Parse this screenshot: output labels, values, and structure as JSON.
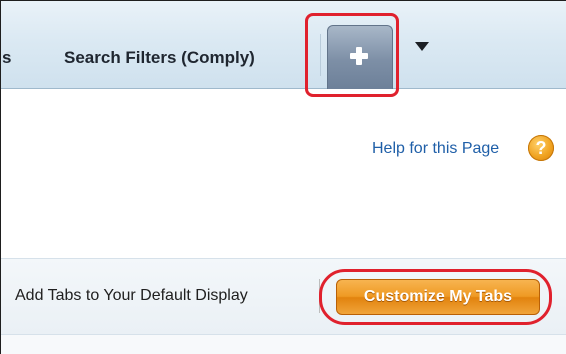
{
  "tabs": {
    "partial_label": "s",
    "search_filters_label": "Search Filters (Comply)",
    "add_tab_icon": "plus-icon",
    "dropdown_icon": "chevron-down-icon"
  },
  "help": {
    "link_label": "Help for this Page",
    "icon_label": "?"
  },
  "tabs_row": {
    "label": "Add Tabs to Your Default Display",
    "customize_button": "Customize My Tabs"
  },
  "colors": {
    "highlight": "#e0212d",
    "button_orange": "#ef9a24",
    "link_blue": "#1f5fa8",
    "tab_gray": "#7d8fa6"
  }
}
